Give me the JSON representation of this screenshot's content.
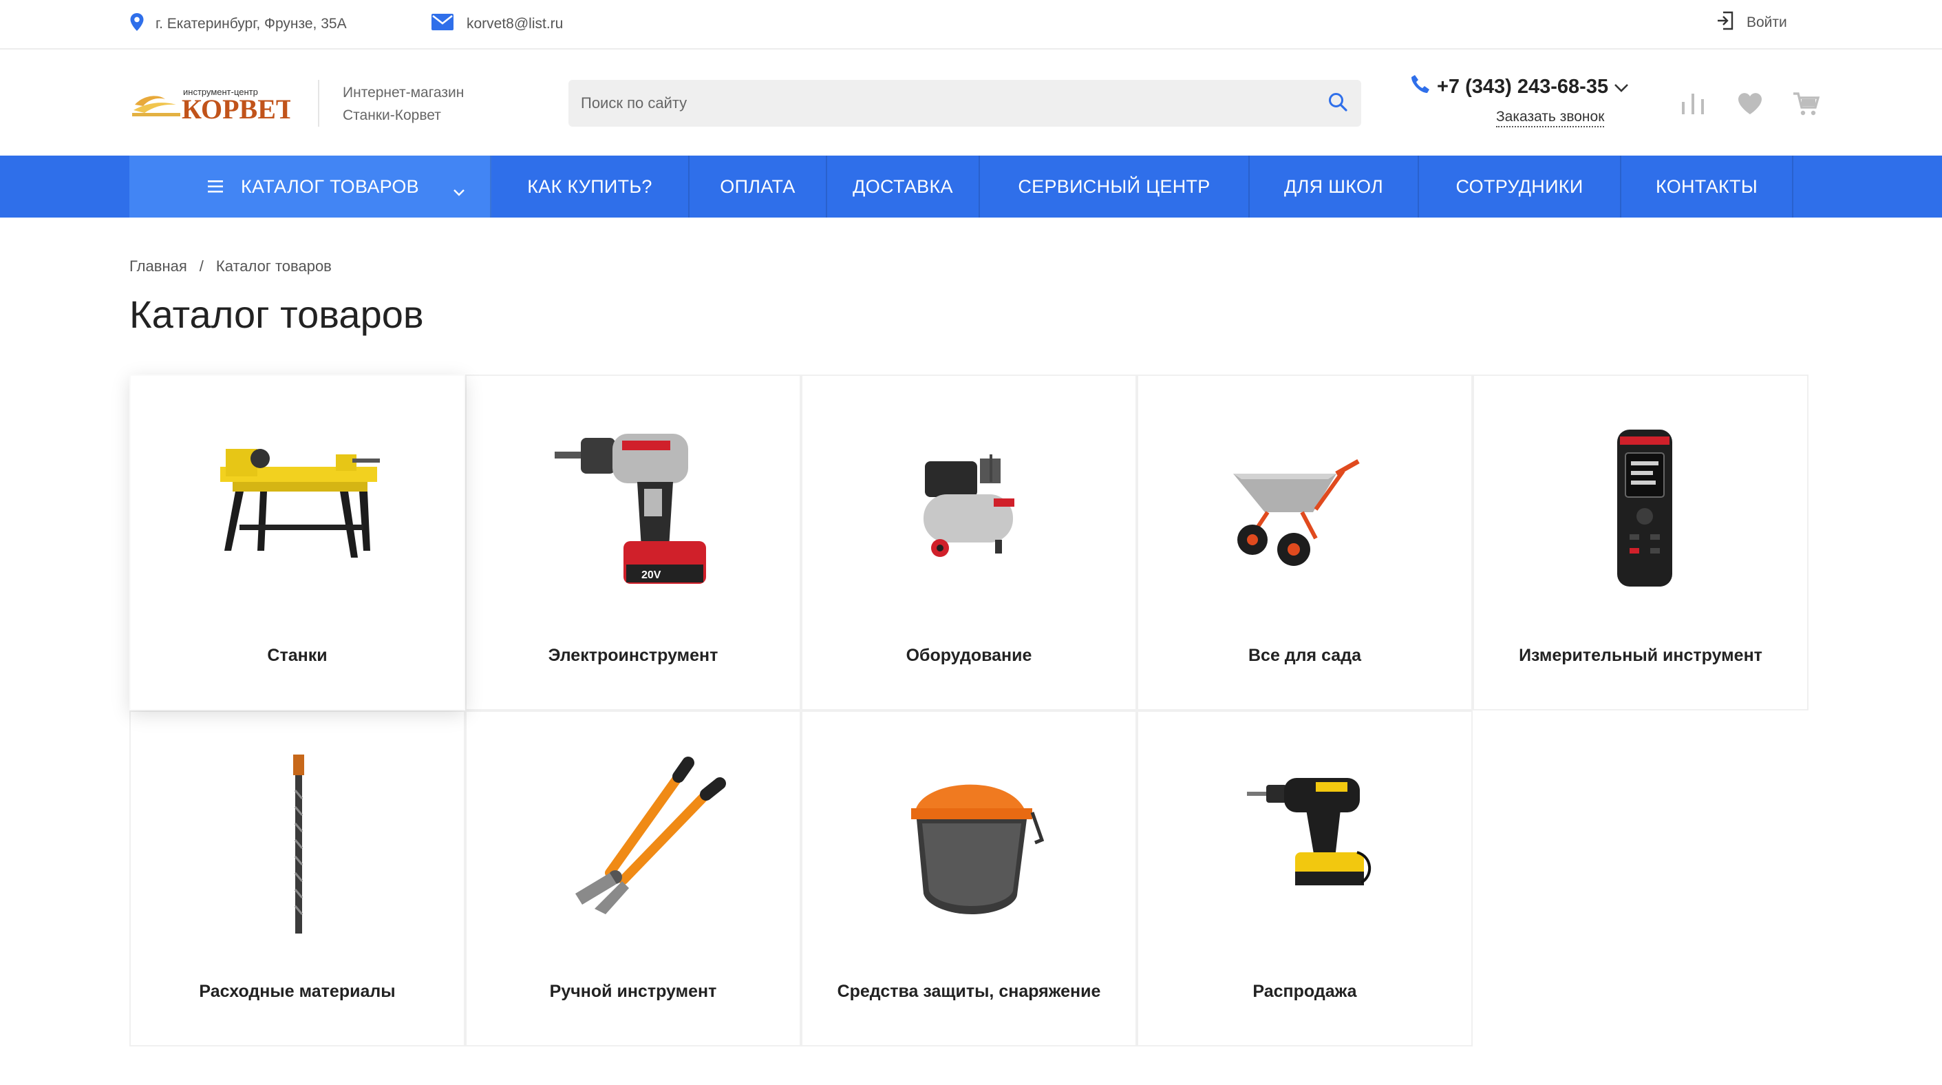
{
  "topbar": {
    "address": "г. Екатеринбург, Фрунзе, 35А",
    "email": "korvet8@list.ru",
    "login_label": "Войти"
  },
  "header": {
    "logo_alt": "Инструмент-центр Корвет",
    "logo_small": "инструмент-центр",
    "logo_big": "КОРВЕТ",
    "shop_line1": "Интернет-магазин",
    "shop_line2": "Станки-Корвет",
    "search_placeholder": "Поиск по сайту",
    "phone": "+7 (343) 243-68-35",
    "callback_label": "Заказать звонок",
    "icons": [
      "compare-icon",
      "heart-icon",
      "cart-icon"
    ]
  },
  "nav": {
    "catalog_label": "КАТАЛОГ ТОВАРОВ",
    "items": [
      {
        "label": "КАК КУПИТЬ?"
      },
      {
        "label": "ОПЛАТА"
      },
      {
        "label": "ДОСТАВКА"
      },
      {
        "label": "СЕРВИСНЫЙ ЦЕНТР"
      },
      {
        "label": "ДЛЯ ШКОЛ"
      },
      {
        "label": "СОТРУДНИКИ"
      },
      {
        "label": "КОНТАКТЫ"
      }
    ]
  },
  "breadcrumb": {
    "home": "Главная",
    "separator": "/",
    "current": "Каталог товаров"
  },
  "page_title": "Каталог товаров",
  "categories": [
    {
      "name": "Станки",
      "icon": "lathe-icon"
    },
    {
      "name": "Электроинструмент",
      "icon": "drill-icon"
    },
    {
      "name": "Оборудование",
      "icon": "compressor-icon"
    },
    {
      "name": "Все для сада",
      "icon": "wheelbarrow-icon"
    },
    {
      "name": "Измерительный инструмент",
      "icon": "rangefinder-icon"
    },
    {
      "name": "Расходные материалы",
      "icon": "drill-bit-icon"
    },
    {
      "name": "Ручной инструмент",
      "icon": "bolt-cutter-icon"
    },
    {
      "name": "Средства защиты, снаряжение",
      "icon": "face-shield-icon"
    },
    {
      "name": "Распродажа",
      "icon": "screwdriver-icon"
    }
  ],
  "colors": {
    "nav_bg": "#2f6fea",
    "nav_catalog_bg": "#4285f4",
    "accent_blue": "#2f6fea",
    "logo_orange": "#d4731a"
  }
}
